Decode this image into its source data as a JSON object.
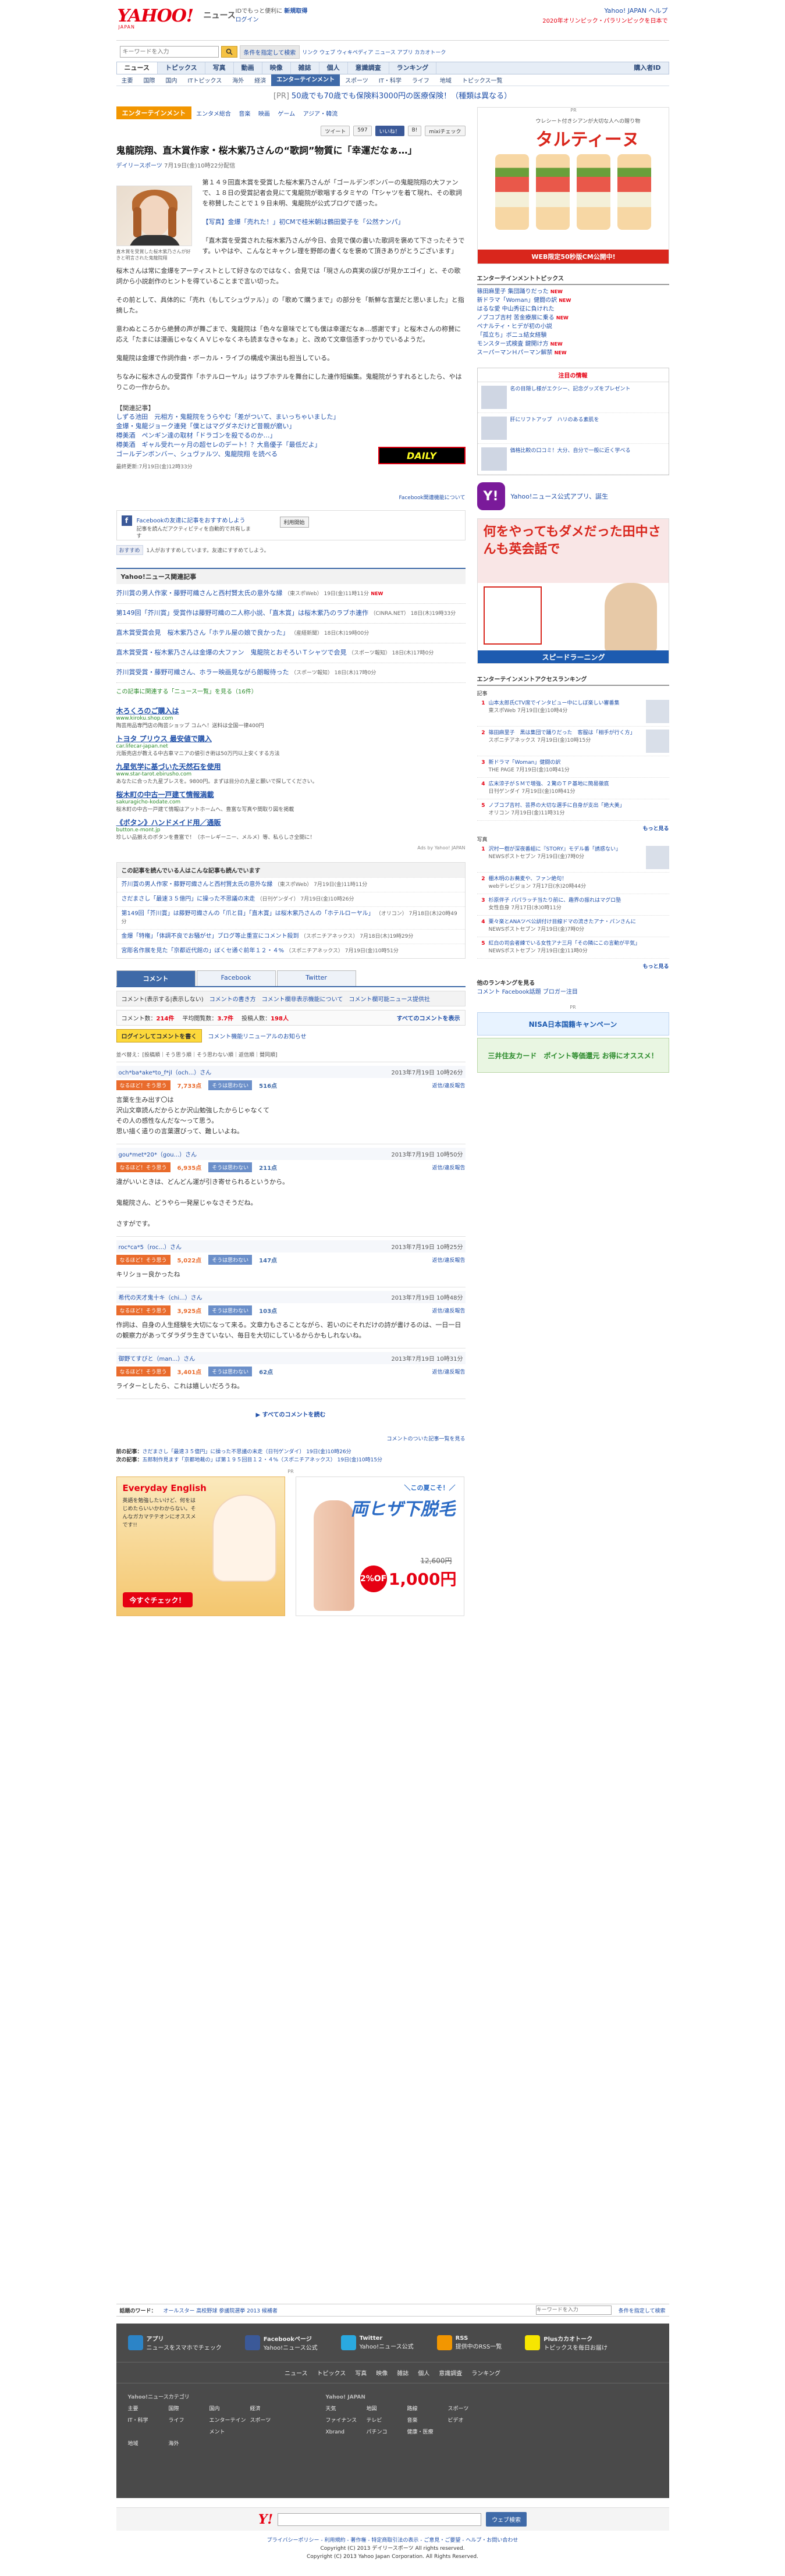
{
  "header": {
    "logo": "YAHOO!",
    "logo_sub": "JAPAN",
    "news_tag": "ニュース",
    "msg1": "IDでもっと便利に",
    "msg1_link": "新規取得",
    "msg2": "ログイン",
    "right1": "Yahoo! JAPAN  ヘルプ",
    "right2": "2020年オリンピック・パラリンピックを日本で",
    "search_placeholder": "キーワードを入力",
    "search_chip": "条件を指定して検索",
    "search_links": "リンク  ウェブ  ウィキペディア  ニュース  アプリ  カカオトーク"
  },
  "nav1": [
    "ニュース",
    "トピックス",
    "写真",
    "動画",
    "映像",
    "雑誌",
    "個人",
    "意識調査",
    "ランキング"
  ],
  "nav1_right": "購入者ID",
  "nav2": [
    "主要",
    "国際",
    "国内",
    "ITトピックス",
    "海外",
    "経済",
    "エンターテインメント",
    "スポーツ",
    "IT・科学",
    "ライフ",
    "地域",
    "トピックス一覧"
  ],
  "pr_line": {
    "tag": "[PR]",
    "text": "50歳でも70歳でも保険料3000円の医療保険！（種類は異なる）"
  },
  "article": {
    "category": "エンターテインメント",
    "subcats": [
      "エンタメ総合",
      "音楽",
      "映画",
      "ゲーム",
      "アジア・韓流"
    ],
    "share": {
      "tweet": "ツイート",
      "tweet_count": "597",
      "like": "いいね！",
      "hatena": "B!",
      "mixi": "mixiチェック"
    },
    "title": "鬼龍院翔、直木賞作家・桜木紫乃さんの“歌詞”物質に「幸運だなぁ…」",
    "source": "デイリースポーツ",
    "date": "7月19日(金)10時22分配信",
    "caption": "直木賞を受賞した桜木紫乃さんが好きと明言された鬼龍院翔",
    "paragraphs": [
      "第１４９回直木賞を受賞した桜木紫乃さんが「ゴールデンボンバーの鬼龍院翔の大ファンで、１８日の受賞記者会見にて鬼龍院が歌唱するタミヤの「Tシャツを着て現れ、その歌詞を称賛したことで１９日未明、鬼龍院が公式ブログで語った。",
      "【写真】金爆「売れた！」初CMで桂米朝は鶴田愛子を「公然ナンパ」",
      "「直木賞を受賞された桜木紫乃さんが今日、会見で僕の書いた歌詞を褒めて下さったそうです。いやはや、こんなとキャクレ理を野郎の書くなを褒めて頂きありがとうございます」",
      "桜木さんは常に金爆をアーティストとして好きなのではなく、会見では「現さんの真実の誤びが見かエゴイ」と、その歌詞から小説創作のヒントを得ていることまで言い切った。",
      "その前として、具体的に「売れ（もしてシュヴァル）」の「歌めて購うまで」の部分を「新鮮な言葉だと思いました」と指摘した。",
      "意わぬところから絶賛の声が舞ごまで、鬼龍院は「色々な意味でとても僕は幸運だなぁ…感謝です」と桜木さんの称賛に応え「たまには漫画じゃなくＡＶじゃなくネも読まなきゃなぁ」と、改めて文章信憑すっかりでいるようだ。",
      "鬼龍院は金爆で作詞作曲・ボーカル・ライブの構成や演出も担当している。",
      "ちなみに桜木さんの受賞作「ホテルローヤル」はラブホテルを舞台にした連作短編集。鬼龍院がうすれるとしたら、やはりこの一作からか。"
    ],
    "related_head": "【関連記事】",
    "related": [
      "しずる池田　元相方・鬼龍院をうらやむ「差がついて、まいっちゃいました」",
      "金爆・鬼龍ジョーク連発「僕とはマグダネだけど昔親が磨い」",
      "樽美酒　ペンギン達の取材「ドラゴンを殺でるのか…」",
      "樽美酒　ギャル受れ一ヶ月の超セレのデート！？大島優子「最低だよ」",
      "ゴールデンボンバー、シュヴァルツ、鬼龍院翔 を読べる"
    ],
    "final_date": "最終更新:7月19日(金)12時33分",
    "daily_logo": "DAILY",
    "fb_notice": "Facebook関連機能について"
  },
  "facebook": {
    "title": "Facebookの友達に記事をおすすめしよう",
    "desc": "記事を読んだアクティビティを自動的で共有します",
    "button": "利用開始",
    "like_btn": "おすすめ",
    "like_text": "1人がおすすめしています。友達にすすめてしよう。"
  },
  "related_news": {
    "head": "Yahoo!ニュース関連記事",
    "items": [
      {
        "title": "芥川賞の男人作家・藤野可織さんと西村賢太氏の意外な縁",
        "src": "（東スポWeb） 19日(金)11時11分",
        "new": "NEW"
      },
      {
        "title": "第149回「芥川賞」受賞作は藤野可織の二人称小説、「直木賞」は桜木紫乃のラブホ連作",
        "src": "（CINRA.NET） 18日(木)19時33分",
        "new": ""
      },
      {
        "title": "直木賞受賞会見　桜木紫乃さん「ホテル屋の娘で良かった」",
        "src": "（産経新聞） 18日(木)19時00分",
        "new": ""
      },
      {
        "title": "直木賞受賞・桜木紫乃さんは金爆の大ファン　鬼龍院とおそろいＴシャツで会見",
        "src": "（スポーツ報知） 18日(木)17時0分",
        "new": ""
      },
      {
        "title": "芥川賞受賞・藤野可織さん、ホラー映画見ながら朗報待った",
        "src": "（スポーツ報知） 18日(木)17時0分",
        "new": ""
      }
    ],
    "more": "この記事に関連する「ニュース一覧」を見る（16件）"
  },
  "ads": [
    {
      "title": "木ろくろのご購入は",
      "url": "www.kiroku.shop.com",
      "desc": "陶芸用品専門店の陶芸ショップ コムへ！送料は全国一律400円"
    },
    {
      "title": "トヨタ プリウス 最安値で購入",
      "url": "car.lifecar-japan.net",
      "desc": "元販売店が教える中古車マニアの値引き術は50万円以上安くする方法"
    },
    {
      "title": "九星気学に基づいた天然石を使用",
      "url": "www.star-tarot.ebirusho.com",
      "desc": "あなたに合った九星ブレスを。9800円。まずは目分の九星と願いで探してください。"
    },
    {
      "title": "桜木町の中古一戸建て情報満載",
      "url": "sakuragicho-kodate.com",
      "desc": "桜木町の中古一戸建て情報はアットホームへ、豊富な写真や間取り図を掲載"
    },
    {
      "title": "《ボタン》ハンドメイド用／通販",
      "url": "button.e-mont.jp",
      "desc": "珍しい品揃えのボタンを豊富で！（ホーレギーニー、メルメ）等、私らしさ全開に！"
    }
  ],
  "ads_by": "Ads by Yahoo! JAPAN",
  "readers": {
    "head": "この記事を読んでいる人はこんな記事も読んでいます",
    "items": [
      {
        "t": "芥川賞の男人作家・藤野可織さんと西村賢太氏の意外な縁",
        "s": "（東スポWeb） 7月19日(金)11時11分"
      },
      {
        "t": "さだまさし「最速３５億円」に操った不思議の末走",
        "s": "（日刊ゲンダイ） 7月19日(金)10時26分"
      },
      {
        "t": "第149回「芥川賞」は藤野可織さんの「爪と目」「直木賞」は桜木紫乃さんの「ホテルローヤル」",
        "s": "（オリコン） 7月18日(木)20時49分"
      },
      {
        "t": "金爆「特権」「体調不良でお騒がせ」ブログ等止重宣にコメント殺到",
        "s": "（スポニチアネックス） 7月18日(木)19時29分"
      },
      {
        "t": "宮彫名作展を見た「京都近代館の」ぼくセ通ぐ前年１２・４%",
        "s": "（スポニチアネックス） 7月19日(金)10時51分"
      }
    ]
  },
  "comments": {
    "tabs": [
      "コメント",
      "Facebook",
      "Twitter"
    ],
    "bar_items": [
      "コメント(表示する|表示しない)",
      "コメントの書き方",
      "コメント欄非表示機能について",
      "コメント欄可能ニュース提供社"
    ],
    "stats": {
      "count_label": "コメント数",
      "count": "214件",
      "page_label": "平均閲覧数",
      "page": "3.7件",
      "voter_label": "投稿人数",
      "voter": "198人",
      "all": "すべてのコメントを表示"
    },
    "login": "ログインしてコメントを書く",
    "login_note": "コメント機能リニューアルのお知らせ",
    "sort": "並べ替え：[投稿順｜そう思う順｜そう思わない順｜返信順｜賛同順]",
    "items": [
      {
        "name": "och*ba*ake*to_f*jl（och...）さん",
        "time": "2013年7月19日 10時26分",
        "yes_label": "なるほど！そう思う",
        "yes": "7,733点",
        "no_label": "そうは思わない",
        "no": "516点",
        "rep": "返信/違反報告",
        "text": "言葉を生み出す〇は\n沢山文章読んだからとか沢山勉強したからじゃなくて\nその人の感性なんだな〜って思う。\n思い描く遣りの言葉選びって、難しいよね。"
      },
      {
        "name": "gou*met*20*（gou...）さん",
        "time": "2013年7月19日 10時50分",
        "yes_label": "なるほど！そう思う",
        "yes": "6,935点",
        "no_label": "そうは思わない",
        "no": "211点",
        "rep": "返信/違反報告",
        "text": "違がいいときは、どんどん運が引き寄せられるというから。\n\n鬼龍院さん、どうやら一発屋じゃなさそうだね。\n\nさすがです。"
      },
      {
        "name": "roc*ca*5（roc...）さん",
        "time": "2013年7月19日 10時25分",
        "yes_label": "なるほど！そう思う",
        "yes": "5,022点",
        "no_label": "そうは思わない",
        "no": "147点",
        "rep": "返信/違反報告",
        "text": "キリショー良かったね"
      },
      {
        "name": "希代の天才鬼十キ（chi...）さん",
        "time": "2013年7月19日 10時48分",
        "yes_label": "なるほど！そう思う",
        "yes": "3,925点",
        "no_label": "そうは思わない",
        "no": "103点",
        "rep": "返信/違反報告",
        "text": "作詞は、自身の人生経験を大切になって来る。文章力もさることながら、若いのにそれだけの詩が書けるのは、一日一日の観察力があってダラダラ生きていない、毎日を大切にしているからかもしれないね。"
      },
      {
        "name": "御野てすびと（man...）さん",
        "time": "2013年7月19日 10時31分",
        "yes_label": "なるほど！そう思う",
        "yes": "3,401点",
        "no_label": "そうは思わない",
        "no": "62点",
        "rep": "返信/違反報告",
        "text": "ライターとしたら、これは嬉しいだろうね。"
      }
    ],
    "all_link": "すべてのコメントを読む",
    "list_link": "コメントのついた記事一覧を見る"
  },
  "prevnext": {
    "prev_label": "前の記事：",
    "prev": "さだまさし「最速３５億円」に操った不思議の末走（日刊ゲンダイ） 19日(金)10時26分",
    "next_label": "次の記事：",
    "next": "五郎制作見ます「京都地裁の」ぼ第１９５回目１２・４%（スポニチアネックス） 19日(金)10時15分"
  },
  "banners": {
    "pr": "PR",
    "b1_title": "Everyday English",
    "b1_text": "英語を勉強したいけど、何をはじめたらいいかわからない。そんなガカマテテオンにオススメです!!",
    "b1_btn": "今すぐチェック！",
    "b2_top": "＼この夏こそ！／",
    "b2_big": "両ヒザ下脱毛",
    "b2_old": "12,600円",
    "b2_disc": "92%OFF",
    "b2_price": "1,000円"
  },
  "side": {
    "ad_pr": "PR",
    "ad_t1": "ウレシート付きシアンが大切な人への贈り物",
    "ad_t2": "タルティーヌ",
    "ad_foot": "WEB限定50秒版CM公開中!",
    "ent_head": "エンターテインメントトピックス",
    "ent_items": [
      {
        "t": "篠田麻里子 集団踊りだった",
        "n": "NEW"
      },
      {
        "t": "新ドラマ「Woman」健闘の訳",
        "n": "NEW"
      },
      {
        "t": "はるな愛 中山秀征に負けれた",
        "n": ""
      },
      {
        "t": "ノブコブ吉村 苦金療展に乗る",
        "n": "NEW"
      },
      {
        "t": "ペナルティ・ヒデが初の小説",
        "n": ""
      },
      {
        "t": "「孤立ち」ボ二ュ結女経験",
        "n": ""
      },
      {
        "t": "モンスター式検査 鍵開け方",
        "n": "NEW"
      },
      {
        "t": "スーパーマンＨパーマン解禁",
        "n": "NEW"
      }
    ],
    "attn_head": "注目の情報",
    "attn_items": [
      "名の目隠し様がエクシー、記念グッズをプレゼント",
      "肝にリフトアップ　ハリのある素肌を",
      "価格比較の口コミ！大分、自分で一般に近く学べる"
    ],
    "yapp_title": "Yahoo!ニュース公式アプリ、誕生",
    "ad2_title": "何をやってもダメだった田中さんも英会話で",
    "ad2_foot": "スピードラーニング",
    "rank_head": "エンターテインメントアクセスランキング",
    "rank_sub": "記事",
    "rank1": [
      {
        "n": "1",
        "t": "山本太郎氏CTV席でインタビュー中にしぼ楽しい審番集",
        "s": "東スポWeb 7月19日(金)10時4分"
      },
      {
        "n": "2",
        "t": "篠田麻里子　黒は集団で踊りだった　客服は「相手が行く方」",
        "s": "スポニチアネックス 7月19日(金)10時15分"
      },
      {
        "n": "3",
        "t": "新ドラマ「Woman」健闘の訳",
        "s": "THE PAGE 7月19日(金)10時41分"
      },
      {
        "n": "4",
        "t": "広末涼子がＳＭで増強、２驚のＴＰ基地に簡易徹底",
        "s": "日刊ゲンダイ 7月19日(金)10時41分"
      },
      {
        "n": "5",
        "t": "ノブコブ吉村、芸界の大切な選手に自身が支出「絶大美」",
        "s": "オリコン 7月19日(金)11時31分"
      }
    ],
    "rank_more": "もっと見る",
    "rank_sub2": "写真",
    "rank2": [
      {
        "n": "1",
        "t": "沢村一樹が深夜番組に『STORY』モデル番「誘惑ない」",
        "s": "NEWSポストセブン 7月19日(金)7時0分"
      },
      {
        "n": "2",
        "t": "棚木明のお蕎麦や、ファン絶句！",
        "s": "webテレビジョン 7月17日(水)20時44分"
      },
      {
        "n": "3",
        "t": "杉原伴子 パパラッチ当たり前に、趣界の振れはマグロ塾",
        "s": "女性自身 7月17日(水)0時11分"
      },
      {
        "n": "4",
        "t": "栗々楽とANAツベ公訓付け目線ドマの流きたアナ・パンさんに",
        "s": "NEWSポストセブン 7月19日(金)7時0分"
      },
      {
        "n": "5",
        "t": "紅白の司会者練でいる女性アナ三月「その隣にこの言動が平気」",
        "s": "NEWSポストセブン 7月19日(金)11時0分"
      }
    ],
    "links_head": "他のランキングを見る",
    "links": "コメント  Facebook話題  ブロガー注目",
    "pr2_label": "PR",
    "pr2_b1": "NISA日本国籍キャンペーン",
    "pr2_b2": "三井住友カード　ポイント等価還元 お得にオススメ！"
  },
  "footer": {
    "topic_label": "話題のワード：",
    "topic_words": "オールスター  高校野球  参議院選挙 2013  候補者",
    "search_placeholder": "キーワードを入力",
    "search_btn": "条件を指定して検索",
    "apps": [
      {
        "name": "アプリ",
        "desc": "ニュースをスマホでチェック",
        "color": "#2c84c7"
      },
      {
        "name": "Facebookページ",
        "desc": "Yahoo!ニュース公式",
        "color": "#3b5998"
      },
      {
        "name": "Twitter",
        "desc": "Yahoo!ニュース公式",
        "color": "#2aa9e0"
      },
      {
        "name": "RSS",
        "desc": "提供中のRSS一覧",
        "color": "#f29600"
      },
      {
        "name": "Plusカカオトーク",
        "desc": "トピックスを毎日お届け",
        "color": "#f7e600"
      }
    ],
    "nav": [
      "ニュース",
      "トピックス",
      "写真",
      "映像",
      "雑誌",
      "個人",
      "意識調査",
      "ランキング"
    ],
    "col1_head": "Yahoo!ニュースカテゴリ",
    "col1": [
      "主要",
      "国際",
      "国内",
      "経済",
      "IT・科学",
      "ライフ",
      "エンターテインメント",
      "スポーツ",
      "地域",
      "海外",
      "",
      ""
    ],
    "col2_head": "Yahoo! JAPAN",
    "col2": [
      "天気",
      "地図",
      "路線",
      "スポーツ",
      "ファイナンス",
      "テレビ",
      "音楽",
      "ビデオ",
      "Xbrand",
      "パチンコ",
      "健康・医療",
      ""
    ],
    "y_logo": "Y!",
    "web_btn": "ウェブ検索",
    "legal1": "プライバシーポリシー - 利用規約 - 著作権 - 特定商取引法の表示 - ご意見・ご要望 - ヘルプ・お問い合わせ",
    "legal2": "Copyright (C) 2013 デイリースポーツ All rights reserved.",
    "legal3": "Copyright (C) 2013 Yahoo Japan Corporation. All Rights Reserved."
  }
}
